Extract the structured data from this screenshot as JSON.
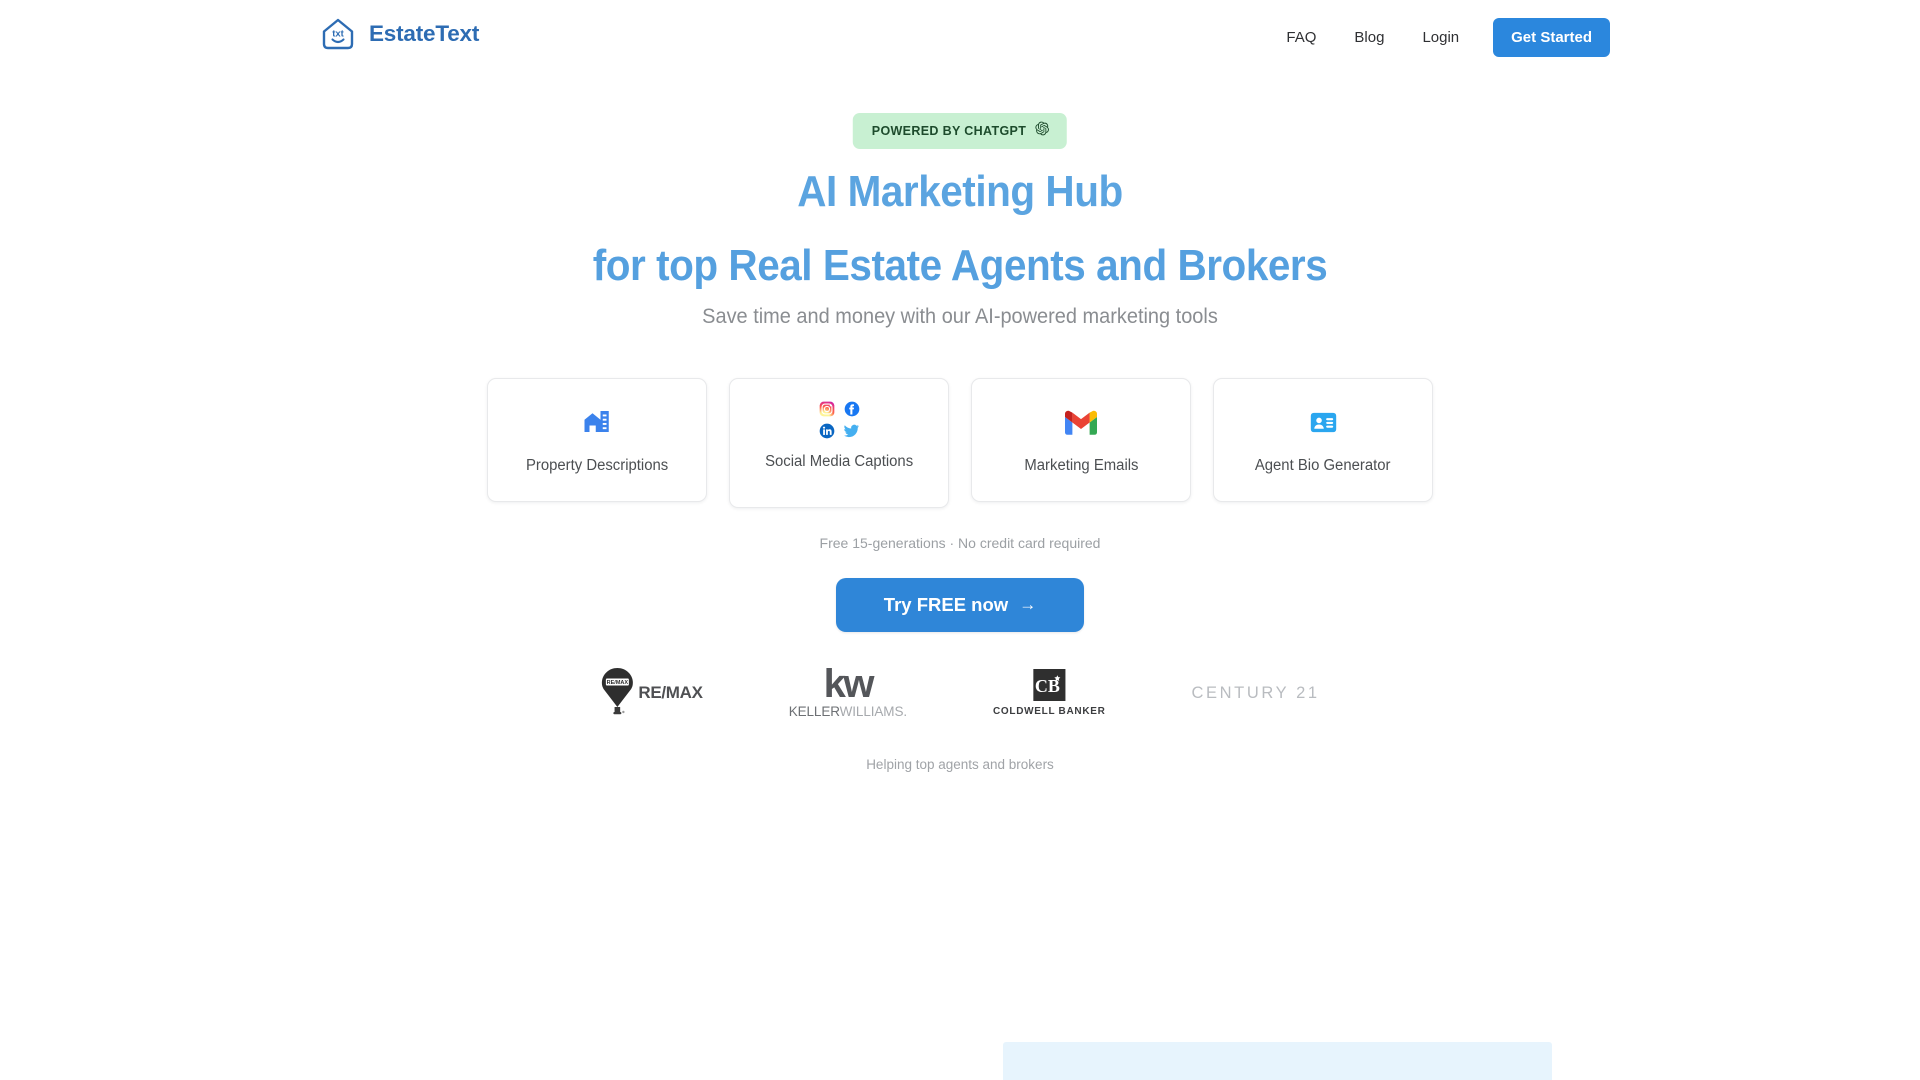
{
  "brand": {
    "name": "EstateText",
    "logo_icon": "house-txt-logo",
    "logo_inner_text": "txt",
    "color": "#2d6cb3"
  },
  "nav": {
    "links": [
      {
        "label": "FAQ",
        "name": "nav-link-faq"
      },
      {
        "label": "Blog",
        "name": "nav-link-blog"
      },
      {
        "label": "Login",
        "name": "nav-link-login"
      }
    ],
    "cta": {
      "label": "Get Started",
      "color": "#2b87dd"
    }
  },
  "hero": {
    "badge": {
      "text": "POWERED BY CHATGPT",
      "icon": "openai-logo-icon",
      "background": "#c8f0d2",
      "text_color": "#1d4b2c"
    },
    "headline_line1": "AI Marketing Hub",
    "headline_line2": "for top Real Estate Agents and Brokers",
    "headline_color": "#5ba4e0",
    "subheadline": "Save time and money with our AI-powered marketing tools"
  },
  "features": {
    "cards": [
      {
        "label": "Property Descriptions",
        "icon": "house-building-icon",
        "icon_color": "#3b82ec"
      },
      {
        "label": "Social Media Captions",
        "icon": "social-icons-grid",
        "social": [
          "instagram-icon",
          "facebook-icon",
          "linkedin-icon",
          "twitter-icon"
        ]
      },
      {
        "label": "Marketing Emails",
        "icon": "gmail-icon"
      },
      {
        "label": "Agent Bio Generator",
        "icon": "id-card-icon",
        "icon_color": "#2aa6ef"
      }
    ]
  },
  "cta": {
    "trial_note": "Free 15-generations · No credit card required",
    "button_label": "Try FREE now",
    "button_arrow": "→",
    "button_color": "#2f86d8"
  },
  "logos": {
    "items": [
      {
        "name": "remax-logo",
        "text": "RE/MAX",
        "balloon_text": "RE/MAX"
      },
      {
        "name": "keller-williams-logo",
        "mark": "kw",
        "word_dark": "KELLER",
        "word_light": "WILLIAMS."
      },
      {
        "name": "coldwell-banker-logo",
        "mark": "CB",
        "text": "COLDWELL BANKER"
      },
      {
        "name": "century21-logo",
        "text": "CENTURY 21"
      }
    ],
    "caption": "Helping top agents and brokers"
  }
}
